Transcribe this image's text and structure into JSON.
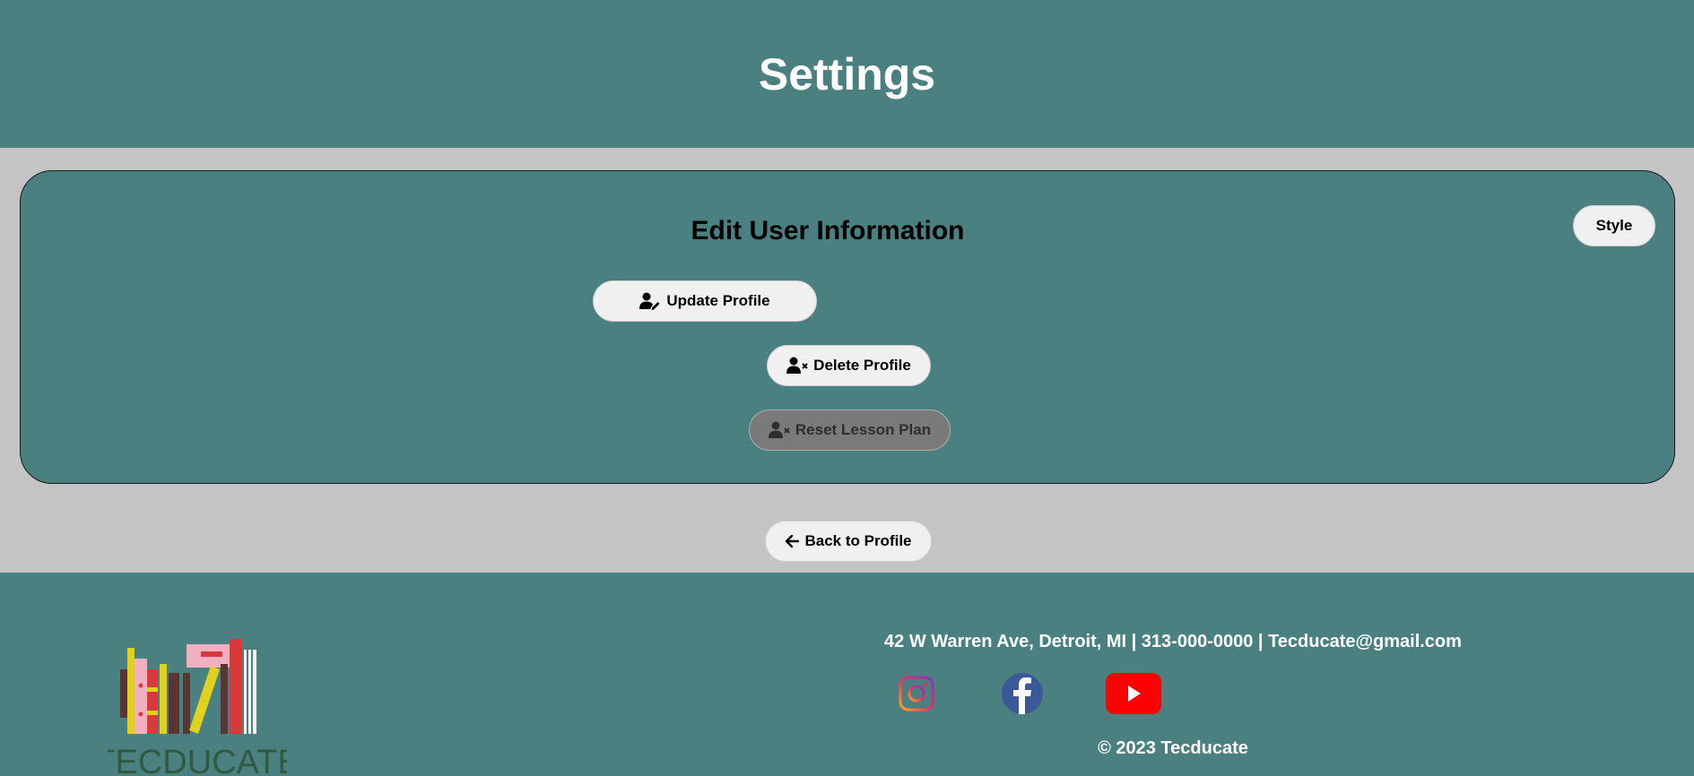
{
  "header": {
    "title": "Settings"
  },
  "card": {
    "title": "Edit User Information",
    "style_button": "Style",
    "update_profile": "Update Profile",
    "delete_profile": "Delete Profile",
    "reset_lesson_plan": "Reset Lesson Plan"
  },
  "nav": {
    "back_to_profile": "Back to Profile"
  },
  "footer": {
    "contact": "42 W Warren Ave, Detroit, MI | 313-000-0000 | Tecducate@gmail.com",
    "copyright": "© 2023 Tecducate",
    "logo_text": "TECDUCATE",
    "social": [
      "instagram-icon",
      "facebook-icon",
      "youtube-icon"
    ]
  },
  "colors": {
    "primary": "#4a8080",
    "background": "#c4c4c4",
    "button": "#f0f0f0",
    "button_disabled": "#7a7a7a",
    "youtube": "#ff0000",
    "facebook": "#3b5998"
  }
}
